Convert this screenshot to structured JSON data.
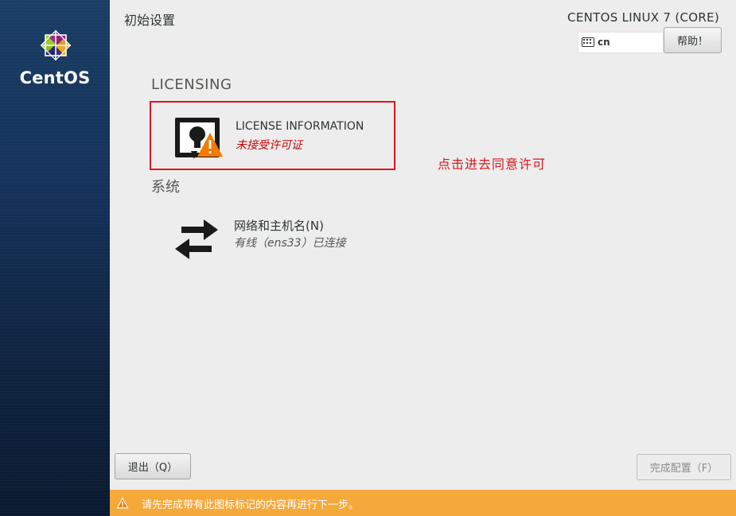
{
  "sidebar": {
    "brand": "CentOS",
    "logo_icon": "centos-logo-icon"
  },
  "header": {
    "title": "初始设置",
    "product": "CENTOS LINUX 7 (CORE)",
    "keyboard_layout": "cn",
    "help_label": "帮助！"
  },
  "sections": {
    "licensing": {
      "heading": "LICENSING",
      "spoke": {
        "title": "LICENSE INFORMATION",
        "status": "未接受许可证",
        "icon": "license-warning-icon"
      }
    },
    "system": {
      "heading": "系统",
      "spoke": {
        "title": "网络和主机名(N)",
        "status": "有线（ens33）已连接",
        "icon": "network-arrows-icon"
      }
    }
  },
  "annotation": "点击进去同意许可",
  "footer": {
    "quit_label": "退出（Q）",
    "finish_label": "完成配置（F）",
    "warning_text": "请先完成带有此图标标记的内容再进行下一步。"
  },
  "colors": {
    "sidebar": "#15325a",
    "warning_bar": "#f5a93b",
    "highlight_box": "#e0141a",
    "error_status": "#cc0000"
  }
}
